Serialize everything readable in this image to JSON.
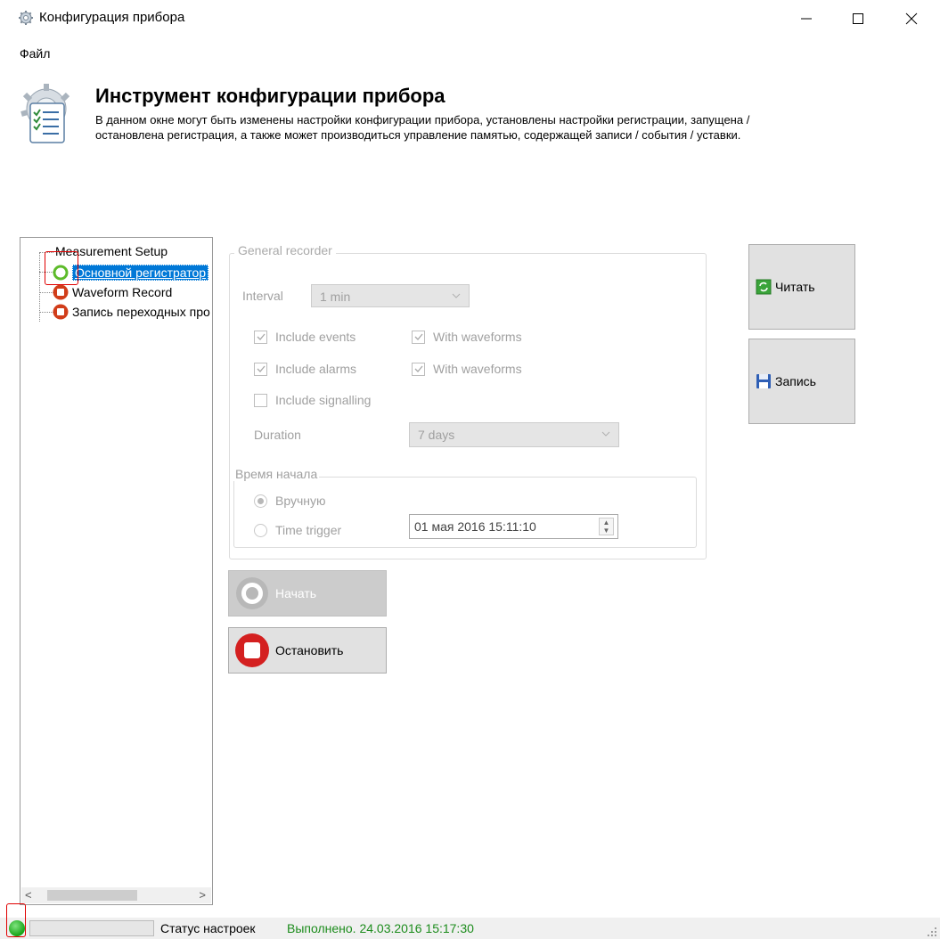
{
  "window": {
    "title": "Конфигурация прибора",
    "minimize_icon": "minimize-icon",
    "maximize_icon": "maximize-icon",
    "close_icon": "close-icon"
  },
  "menu": {
    "file": "Файл"
  },
  "header": {
    "title": "Инструмент конфигурации прибора",
    "description_line1": "В данном окне могут быть изменены настройки конфигурации прибора, установлены настройки регистрации, запущена /",
    "description_line2": "остановлена регистрация, а также может производиться управление памятью, содержащей записи / события / уставки."
  },
  "tree": {
    "root": "Measurement Setup",
    "items": [
      {
        "label": "Основной регистратор",
        "state": "active",
        "selected": true
      },
      {
        "label": "Waveform Record",
        "state": "stopped",
        "selected": false
      },
      {
        "label": "Запись переходных процессов",
        "state": "stopped",
        "selected": false
      }
    ]
  },
  "general_recorder": {
    "title": "General recorder",
    "interval_label": "Interval",
    "interval_value": "1 min",
    "include_events": "Include events",
    "include_events_checked": true,
    "with_waveforms_1": "With waveforms",
    "with_waveforms_1_checked": true,
    "include_alarms": "Include alarms",
    "include_alarms_checked": true,
    "with_waveforms_2": "With waveforms",
    "with_waveforms_2_checked": true,
    "include_signalling": "Include signalling",
    "include_signalling_checked": false,
    "duration_label": "Duration",
    "duration_value": "7 days",
    "start_time": {
      "title": "Время начала",
      "manual": "Вручную",
      "manual_selected": true,
      "time_trigger": "Time trigger",
      "time_trigger_selected": false,
      "datetime": "01 мая 2016 15:11:10"
    }
  },
  "buttons": {
    "start": "Начать",
    "stop": "Остановить",
    "read": "Читать",
    "write": "Запись"
  },
  "status": {
    "label": "Статус настроек",
    "value": "Выполнено. 24.03.2016 15:17:30",
    "led_color": "#17a417"
  }
}
